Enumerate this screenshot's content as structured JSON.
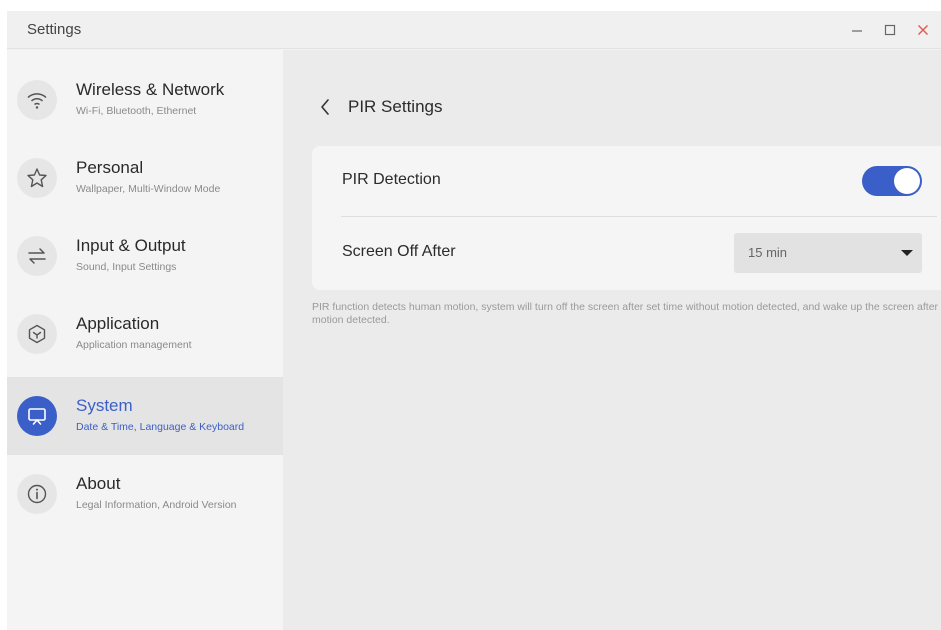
{
  "window": {
    "title": "Settings"
  },
  "sidebar": {
    "items": [
      {
        "label": "Wireless & Network",
        "sub": "Wi-Fi, Bluetooth, Ethernet",
        "icon": "wifi-icon",
        "active": false
      },
      {
        "label": "Personal",
        "sub": "Wallpaper, Multi-Window Mode",
        "icon": "star-icon",
        "active": false
      },
      {
        "label": "Input & Output",
        "sub": "Sound, Input Settings",
        "icon": "arrows-exchange-icon",
        "active": false
      },
      {
        "label": "Application",
        "sub": "Application management",
        "icon": "cube-icon",
        "active": false
      },
      {
        "label": "System",
        "sub": "Date & Time, Language & Keyboard",
        "icon": "monitor-icon",
        "active": true
      },
      {
        "label": "About",
        "sub": "Legal Information, Android Version",
        "icon": "info-icon",
        "active": false
      }
    ]
  },
  "page": {
    "title": "PIR Settings",
    "pir_detection": {
      "label": "PIR Detection",
      "enabled": true
    },
    "screen_off": {
      "label": "Screen Off After",
      "value": "15 min"
    },
    "hint": "PIR function detects human motion, system will turn off the screen after set time without motion detected, and wake up the screen after motion detected."
  },
  "colors": {
    "accent": "#3b5fc8",
    "close": "#e05a4f"
  }
}
